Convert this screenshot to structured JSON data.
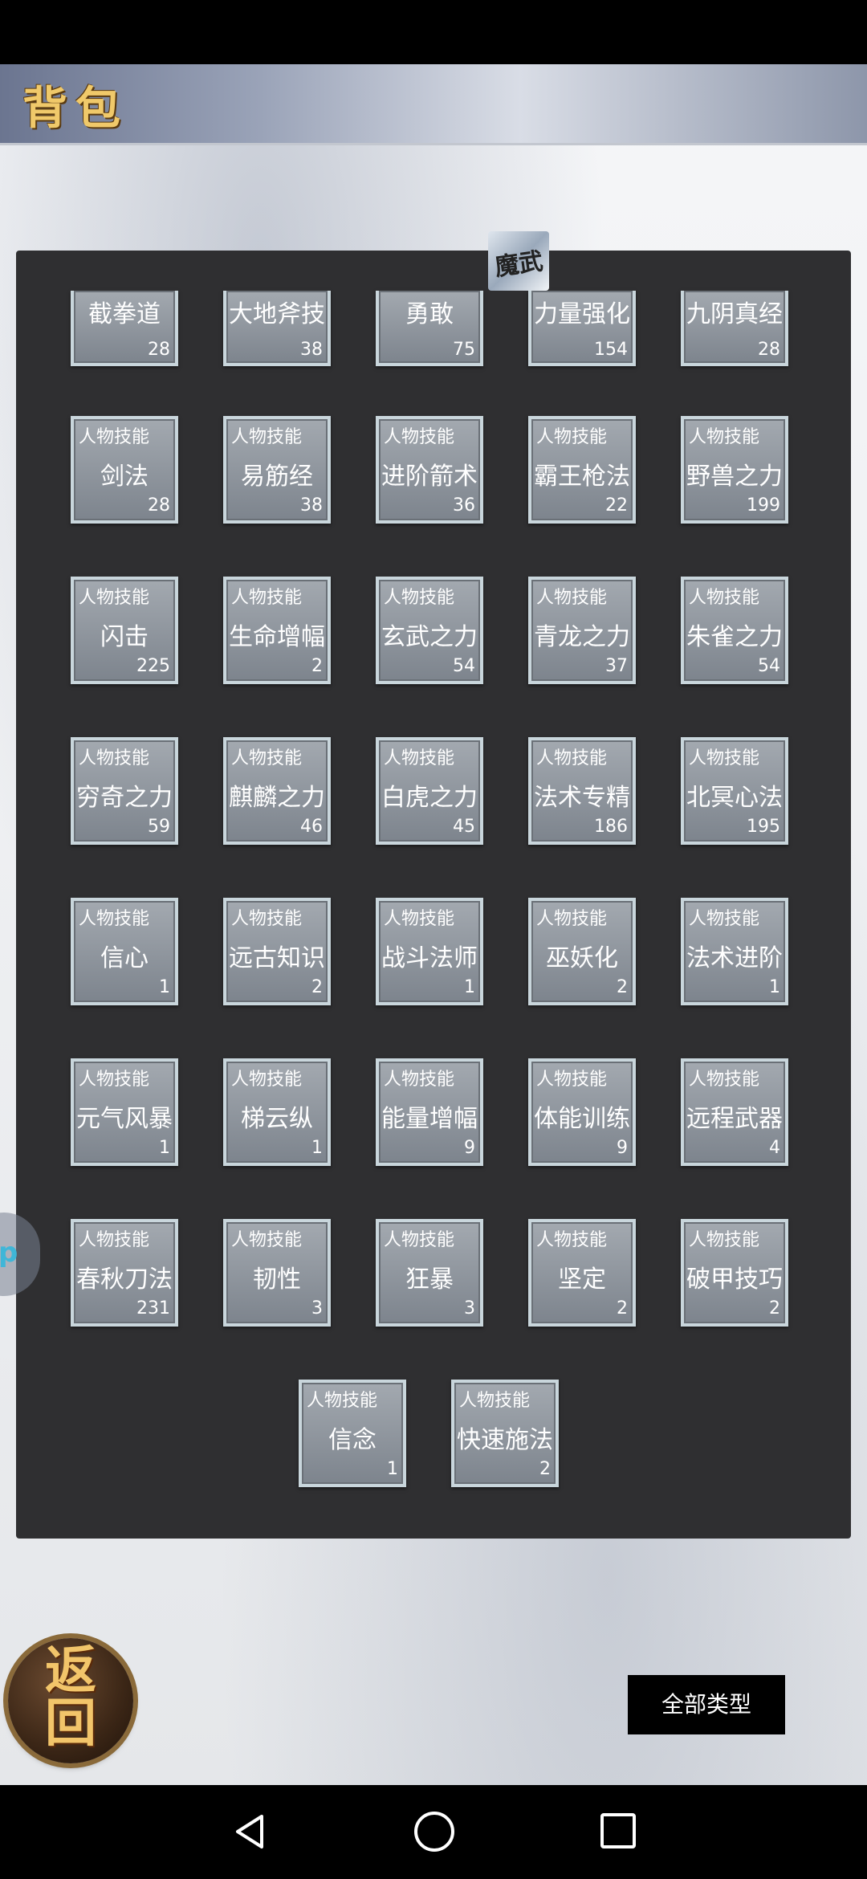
{
  "header": {
    "title": "背包"
  },
  "badge": {
    "text": "魔武"
  },
  "float_tab": {
    "text": "p"
  },
  "items": [
    {
      "name": "截拳道",
      "count": "28"
    },
    {
      "name": "大地斧技",
      "count": "38"
    },
    {
      "name": "勇敢",
      "count": "75"
    },
    {
      "name": "力量强化",
      "count": "154"
    },
    {
      "name": "九阴真经",
      "count": "28"
    },
    {
      "type": "人物技能",
      "name": "剑法",
      "count": "28"
    },
    {
      "type": "人物技能",
      "name": "易筋经",
      "count": "38"
    },
    {
      "type": "人物技能",
      "name": "进阶箭术",
      "count": "36"
    },
    {
      "type": "人物技能",
      "name": "霸王枪法",
      "count": "22"
    },
    {
      "type": "人物技能",
      "name": "野兽之力",
      "count": "199"
    },
    {
      "type": "人物技能",
      "name": "闪击",
      "count": "225"
    },
    {
      "type": "人物技能",
      "name": "生命增幅",
      "count": "2"
    },
    {
      "type": "人物技能",
      "name": "玄武之力",
      "count": "54"
    },
    {
      "type": "人物技能",
      "name": "青龙之力",
      "count": "37"
    },
    {
      "type": "人物技能",
      "name": "朱雀之力",
      "count": "54"
    },
    {
      "type": "人物技能",
      "name": "穷奇之力",
      "count": "59"
    },
    {
      "type": "人物技能",
      "name": "麒麟之力",
      "count": "46"
    },
    {
      "type": "人物技能",
      "name": "白虎之力",
      "count": "45"
    },
    {
      "type": "人物技能",
      "name": "法术专精",
      "count": "186"
    },
    {
      "type": "人物技能",
      "name": "北冥心法",
      "count": "195"
    },
    {
      "type": "人物技能",
      "name": "信心",
      "count": "1"
    },
    {
      "type": "人物技能",
      "name": "远古知识",
      "count": "2"
    },
    {
      "type": "人物技能",
      "name": "战斗法师",
      "count": "1"
    },
    {
      "type": "人物技能",
      "name": "巫妖化",
      "count": "2"
    },
    {
      "type": "人物技能",
      "name": "法术进阶",
      "count": "1"
    },
    {
      "type": "人物技能",
      "name": "元气风暴",
      "count": "1"
    },
    {
      "type": "人物技能",
      "name": "梯云纵",
      "count": "1"
    },
    {
      "type": "人物技能",
      "name": "能量增幅",
      "count": "9"
    },
    {
      "type": "人物技能",
      "name": "体能训练",
      "count": "9"
    },
    {
      "type": "人物技能",
      "name": "远程武器",
      "count": "4"
    },
    {
      "type": "人物技能",
      "name": "春秋刀法",
      "count": "231"
    },
    {
      "type": "人物技能",
      "name": "韧性",
      "count": "3"
    },
    {
      "type": "人物技能",
      "name": "狂暴",
      "count": "3"
    },
    {
      "type": "人物技能",
      "name": "坚定",
      "count": "2"
    },
    {
      "type": "人物技能",
      "name": "破甲技巧",
      "count": "2"
    },
    {
      "type": "人物技能",
      "name": "信念",
      "count": "1"
    },
    {
      "type": "人物技能",
      "name": "快速施法",
      "count": "2"
    }
  ],
  "back_button": {
    "label": "返回"
  },
  "filter_button": {
    "label": "全部类型"
  },
  "navbar": {
    "icons": [
      "back-triangle-icon",
      "home-circle-icon",
      "recent-square-icon"
    ]
  }
}
